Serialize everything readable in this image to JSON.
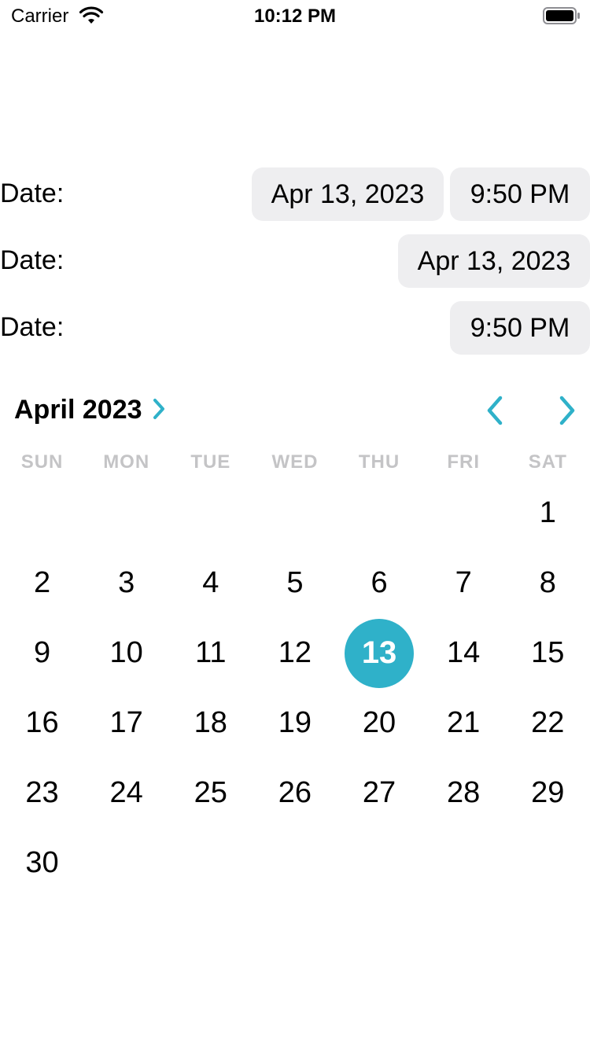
{
  "status_bar": {
    "carrier": "Carrier",
    "time": "10:12 PM",
    "icons": [
      "wifi-icon",
      "battery-icon"
    ]
  },
  "rows": [
    {
      "label": "Date:",
      "date": "Apr 13, 2023",
      "time": "9:50 PM"
    },
    {
      "label": "Date:",
      "date": "Apr 13, 2023"
    },
    {
      "label": "Date:",
      "time": "9:50 PM"
    }
  ],
  "calendar": {
    "month_title": "April 2023",
    "accent_color": "#2fb1c9",
    "weekdays": [
      "SUN",
      "MON",
      "TUE",
      "WED",
      "THU",
      "FRI",
      "SAT"
    ],
    "weeks": [
      [
        "",
        "",
        "",
        "",
        "",
        "",
        "1"
      ],
      [
        "2",
        "3",
        "4",
        "5",
        "6",
        "7",
        "8"
      ],
      [
        "9",
        "10",
        "11",
        "12",
        "13",
        "14",
        "15"
      ],
      [
        "16",
        "17",
        "18",
        "19",
        "20",
        "21",
        "22"
      ],
      [
        "23",
        "24",
        "25",
        "26",
        "27",
        "28",
        "29"
      ],
      [
        "30",
        "",
        "",
        "",
        "",
        "",
        ""
      ]
    ],
    "selected_day": "13",
    "nav_icons": [
      "chevron-left-icon",
      "chevron-right-icon"
    ]
  }
}
